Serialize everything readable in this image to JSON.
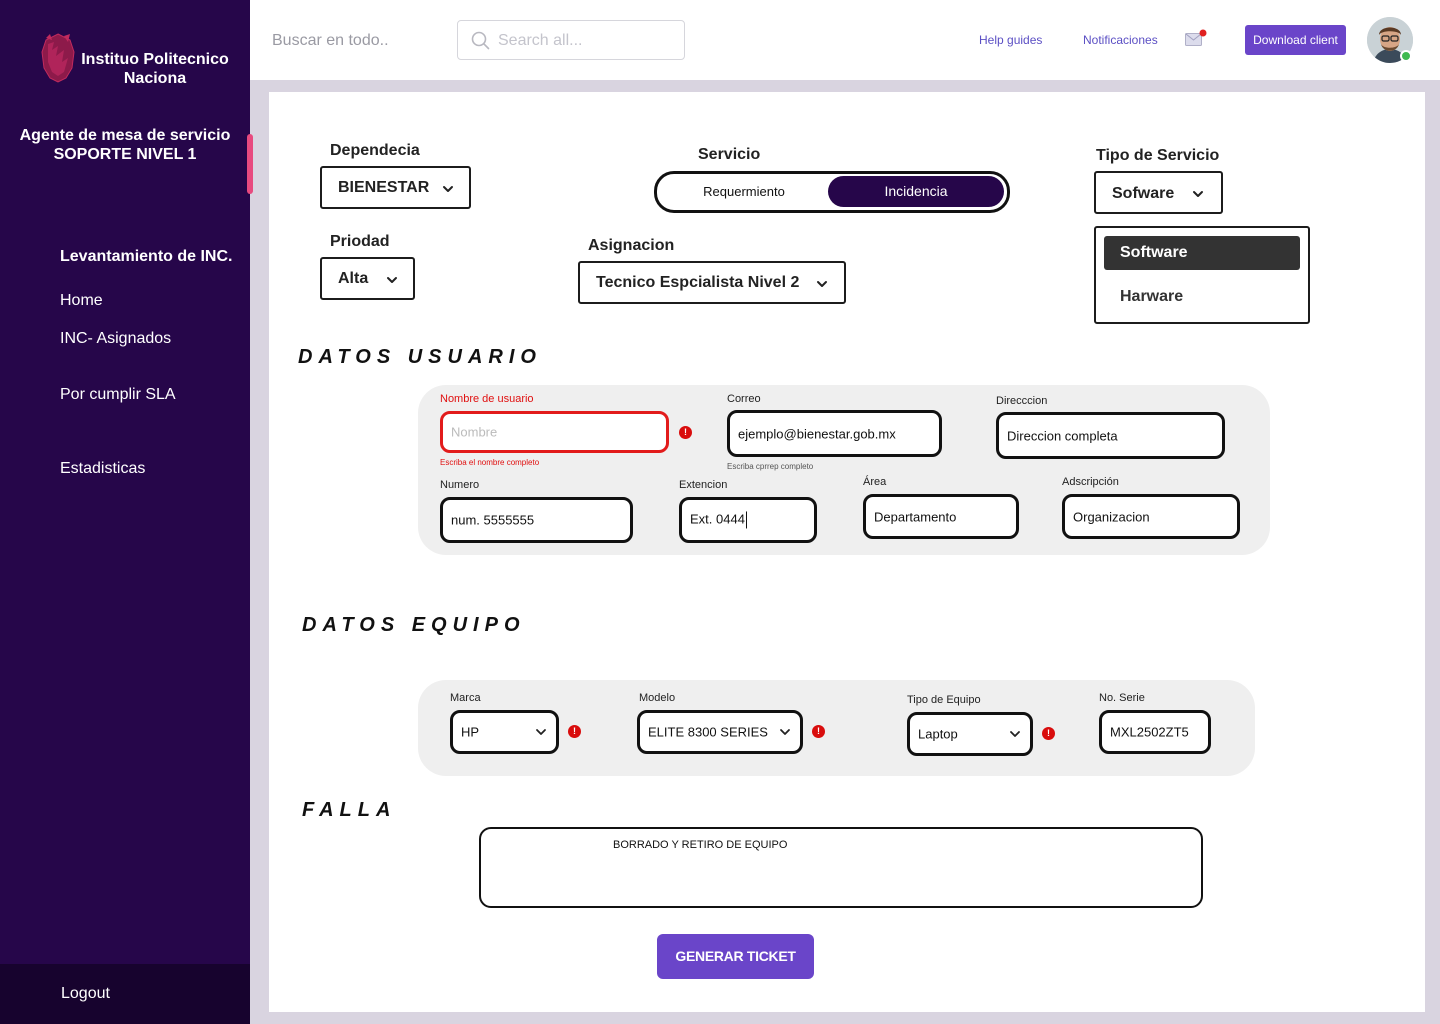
{
  "sidebar": {
    "brand": "Instituo Politecnico Naciona",
    "role_line1": "Agente de mesa de servicio",
    "role_line2": "SOPORTE NIVEL 1",
    "items": [
      {
        "label": "Levantamiento de INC."
      },
      {
        "label": "Home"
      },
      {
        "label": "INC- Asignados"
      },
      {
        "label": "Por cumplir SLA"
      },
      {
        "label": "Estadisticas"
      }
    ],
    "logout": "Logout"
  },
  "header": {
    "search_hint": "Buscar en todo..",
    "search_placeholder": "Search all...",
    "help_link": "Help guides",
    "notifications_link": "Notificaciones",
    "download_button": "Download client"
  },
  "form": {
    "dependencia": {
      "label": "Dependecia",
      "value": "BIENESTAR"
    },
    "servicio": {
      "label": "Servicio",
      "options": [
        "Requermiento",
        "Incidencia"
      ],
      "selected": "Incidencia"
    },
    "tipo_servicio": {
      "label": "Tipo de Servicio",
      "value": "Sofware",
      "options": [
        "Software",
        "Harware"
      ],
      "highlighted": "Software"
    },
    "prioridad": {
      "label": "Priodad",
      "value": "Alta"
    },
    "asignacion": {
      "label": "Asignacion",
      "value": "Tecnico Espcialista Nivel 2"
    }
  },
  "datos_usuario": {
    "title": "DATOS USUARIO",
    "nombre": {
      "label": "Nombre de usuario",
      "placeholder": "Nombre",
      "error": "Escriba el nombre  completo"
    },
    "correo": {
      "label": "Correo",
      "value": "ejemplo@bienestar.gob.mx",
      "hint": "Escriba cprrep completo"
    },
    "direccion": {
      "label": "Direcccion",
      "value": "Direccion completa"
    },
    "numero": {
      "label": "Numero",
      "value": "num. 5555555"
    },
    "extension": {
      "label": "Extencion",
      "value": "Ext. 0444"
    },
    "area": {
      "label": "Área",
      "value": "Departamento"
    },
    "adscripcion": {
      "label": "Adscripción",
      "value": "Organizacion"
    }
  },
  "datos_equipo": {
    "title": "DATOS EQUIPO",
    "marca": {
      "label": "Marca",
      "value": "HP"
    },
    "modelo": {
      "label": "Modelo",
      "value": "ELITE 8300 SERIES"
    },
    "tipo_equipo": {
      "label": "Tipo de Equipo",
      "value": "Laptop"
    },
    "serie": {
      "label": "No. Serie",
      "value": "MXL2502ZT5"
    }
  },
  "falla": {
    "title": "FALLA",
    "value": "BORRADO Y RETIRO DE EQUIPO"
  },
  "submit_label": "GENERAR TICKET",
  "error_glyph": "!",
  "colors": {
    "sidebar_bg": "#26064a",
    "accent": "#6a45c9",
    "error": "#e21b1b",
    "indicator": "#e84a7f",
    "online": "#3fb950"
  }
}
